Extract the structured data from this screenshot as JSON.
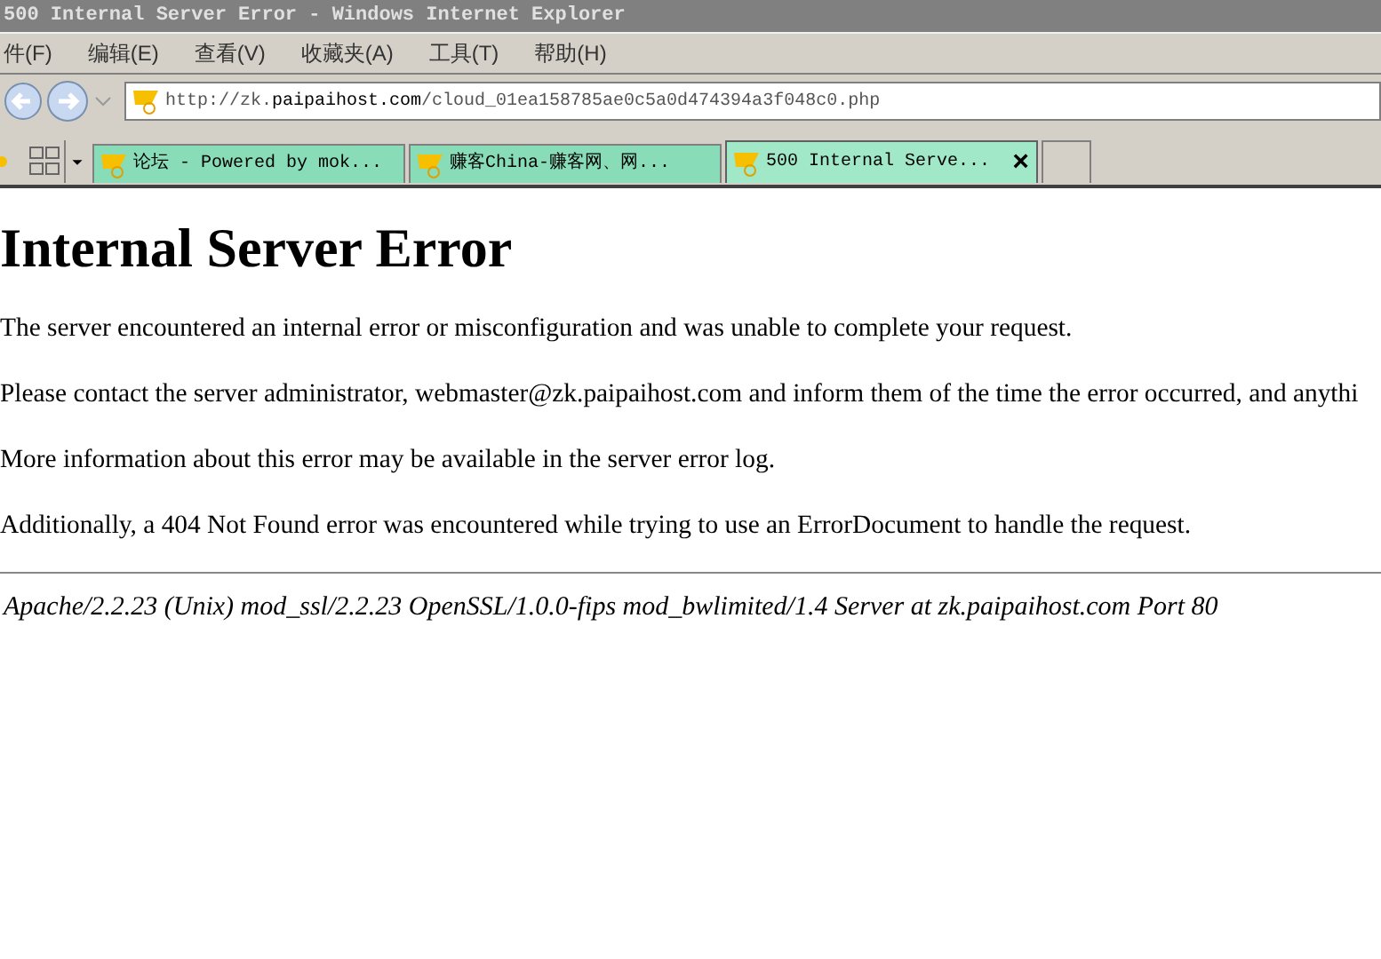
{
  "window": {
    "title": "500 Internal Server Error - Windows Internet Explorer"
  },
  "menu": [
    "件(F)",
    "编辑(E)",
    "查看(V)",
    "收藏夹(A)",
    "工具(T)",
    "帮助(H)"
  ],
  "address": {
    "value_host_prefix": "http://zk.",
    "value_host": "paipaihost.com",
    "value_path": "/cloud_01ea158785ae0c5a0d474394a3f048c0.php"
  },
  "tabs": [
    {
      "label": "论坛 - Powered by mok...",
      "selected": false
    },
    {
      "label": "赚客China-赚客网、网...",
      "selected": false
    },
    {
      "label": "500 Internal Serve...",
      "selected": true,
      "close": "×"
    }
  ],
  "page": {
    "heading": "Internal Server Error",
    "paragraphs": [
      "The server encountered an internal error or misconfiguration and was unable to complete your request.",
      "Please contact the server administrator, webmaster@zk.paipaihost.com and inform them of the time the error occurred, and anythi",
      "More information about this error may be available in the server error log.",
      "Additionally, a 404 Not Found error was encountered while trying to use an ErrorDocument to handle the request."
    ],
    "footer": "Apache/2.2.23 (Unix) mod_ssl/2.2.23 OpenSSL/1.0.0-fips mod_bwlimited/1.4 Server at zk.paipaihost.com Port 80"
  }
}
